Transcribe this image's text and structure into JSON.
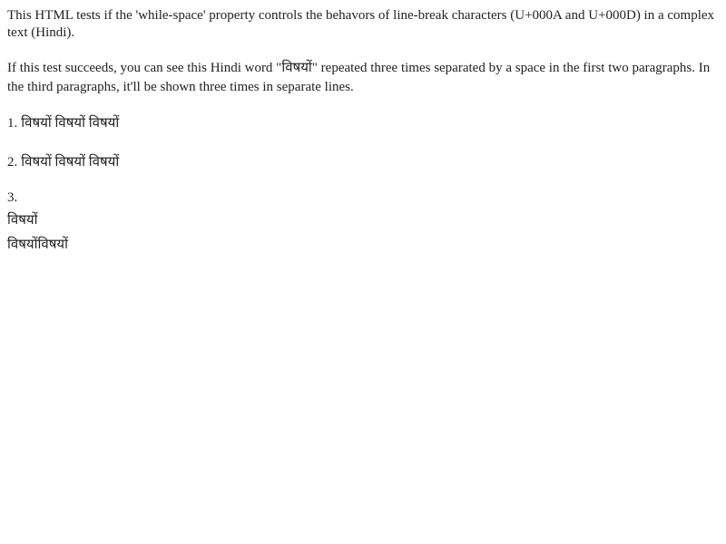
{
  "intro": "This HTML tests if the 'while-space' property controls the behavors of line-break characters (U+000A and U+000D) in a complex text (Hindi).",
  "expectation": {
    "before": "If this test succeeds, you can see this Hindi word \"",
    "word": "विषयों",
    "after": "\" repeated three times separated by a space in the first two paragraphs. In the third paragraphs, it'll be shown three times in separate lines."
  },
  "cases": [
    {
      "number": "1.",
      "words": [
        "विषयों",
        "विषयों",
        "विषयों"
      ]
    },
    {
      "number": "2.",
      "words": [
        "विषयों",
        "विषयों",
        "विषयों"
      ]
    },
    {
      "number": "3.",
      "lines": [
        "विषयों",
        "विषयोंविषयों"
      ]
    }
  ]
}
